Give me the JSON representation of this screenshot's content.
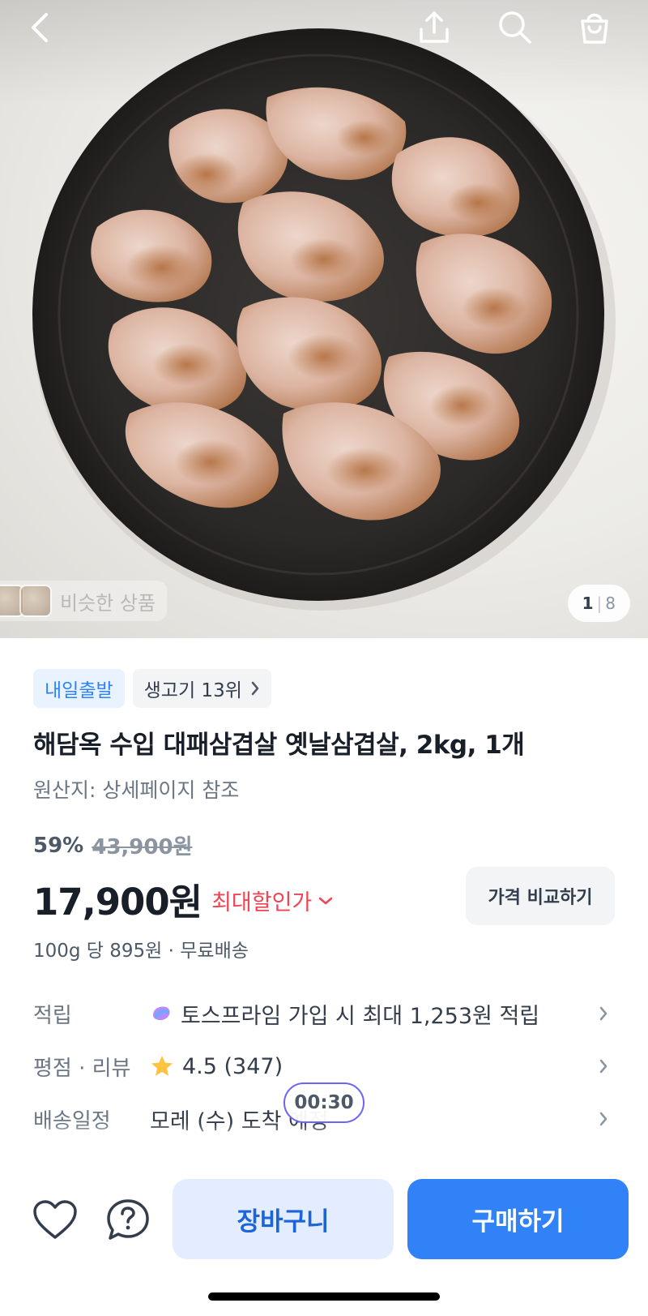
{
  "hero": {
    "similar_label": "비슷한 상품",
    "counter_current": "1",
    "counter_sep": "|",
    "counter_total": "8"
  },
  "header": {
    "icons": [
      "back-icon",
      "share-icon",
      "search-icon",
      "cart-bag-icon"
    ]
  },
  "product": {
    "badge_delivery": "내일출발",
    "badge_rank": "생고기 13위",
    "title": "해담옥 수입 대패삼겹살 옛날삼겹살, 2kg, 1개",
    "origin": "원산지: 상세페이지 참조",
    "discount_rate": "59%",
    "original_price": "43,900원",
    "price": "17,900원",
    "max_discount_label": "최대할인가",
    "compare_button": "가격 비교하기",
    "unit_price": "100g 당 895원 · 무료배송"
  },
  "info_rows": {
    "points": {
      "key": "적립",
      "value": "토스프라임 가입 시 최대 1,253원 적립"
    },
    "rating": {
      "key": "평점 · 리뷰",
      "value": "4.5 (347)"
    },
    "delivery": {
      "key": "배송일정",
      "value": "모레 (수) 도착 예정"
    }
  },
  "timer": "00:30",
  "bottom_bar": {
    "cart_button": "장바구니",
    "buy_button": "구매하기"
  },
  "colors": {
    "accent_blue": "#3182f6",
    "discount_red": "#f04452",
    "star_yellow": "#ffc342"
  }
}
